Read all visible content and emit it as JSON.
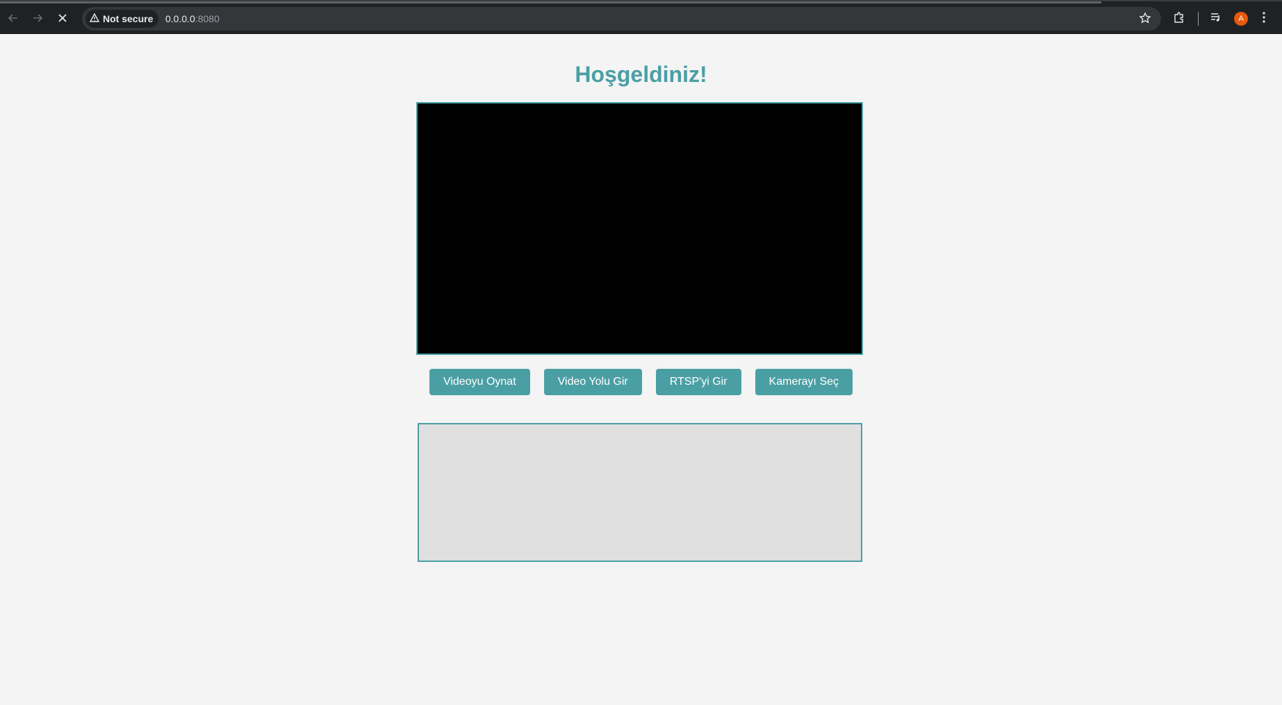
{
  "browser": {
    "security_label": "Not secure",
    "url_host": "0.0.0.0",
    "url_port": ":8080",
    "avatar_letter": "A",
    "icons": [
      "back-arrow-icon",
      "forward-arrow-icon",
      "stop-loading-icon",
      "warning-icon",
      "star-icon",
      "extensions-icon",
      "media-controls-icon",
      "kebab-menu-icon"
    ]
  },
  "page": {
    "title": "Hoşgeldiniz!",
    "buttons": {
      "play_video": "Videoyu Oynat",
      "enter_video_path": "Video Yolu Gir",
      "enter_rtsp": "RTSP'yi Gir",
      "select_camera": "Kamerayı Seç"
    },
    "colors": {
      "accent": "#4a9fa4",
      "background": "#f4f4f4",
      "video_bg": "#000000",
      "output_bg": "#e0e0e0"
    }
  }
}
